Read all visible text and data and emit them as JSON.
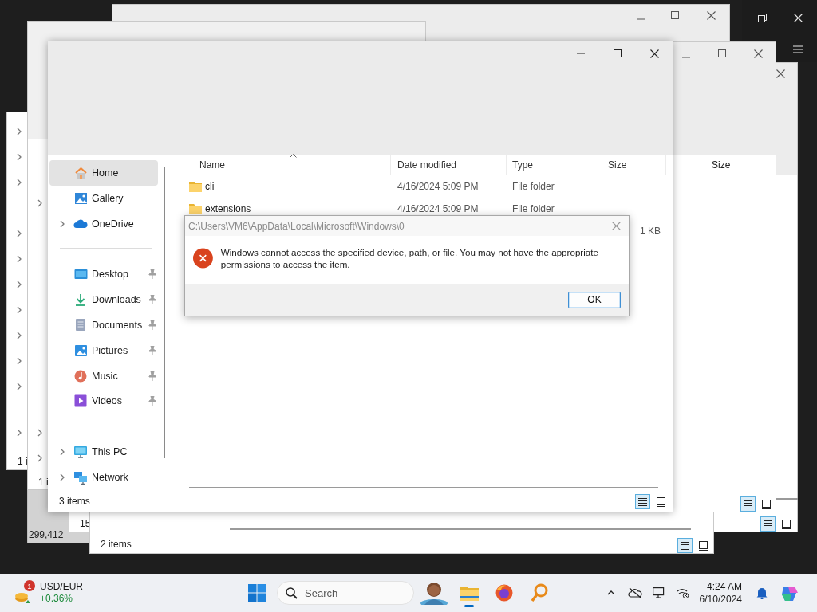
{
  "background_windows": [
    {
      "status": "1 i"
    },
    {
      "status": "299,412"
    },
    {
      "status": "15"
    },
    {
      "status": "1 i"
    },
    {
      "details_view_selected": true
    },
    {
      "status": "2 items",
      "details_view_selected": true
    },
    {
      "column": "Size",
      "details_view_selected": true
    }
  ],
  "explorer": {
    "sidebar_groups": [
      {
        "items": [
          {
            "label": "Home",
            "kind": "home",
            "selected": true,
            "expandable": false,
            "pinned": false
          },
          {
            "label": "Gallery",
            "kind": "gallery",
            "selected": false,
            "expandable": false,
            "pinned": false
          },
          {
            "label": "OneDrive",
            "kind": "onedrive",
            "selected": false,
            "expandable": true,
            "pinned": false
          }
        ]
      },
      {
        "items": [
          {
            "label": "Desktop",
            "kind": "desktop",
            "selected": false,
            "expandable": false,
            "pinned": true
          },
          {
            "label": "Downloads",
            "kind": "downloads",
            "selected": false,
            "expandable": false,
            "pinned": true
          },
          {
            "label": "Documents",
            "kind": "documents",
            "selected": false,
            "expandable": false,
            "pinned": true
          },
          {
            "label": "Pictures",
            "kind": "pictures",
            "selected": false,
            "expandable": false,
            "pinned": true
          },
          {
            "label": "Music",
            "kind": "music",
            "selected": false,
            "expandable": false,
            "pinned": true
          },
          {
            "label": "Videos",
            "kind": "videos",
            "selected": false,
            "expandable": false,
            "pinned": true
          }
        ]
      },
      {
        "items": [
          {
            "label": "This PC",
            "kind": "thispc",
            "selected": false,
            "expandable": true,
            "pinned": false
          },
          {
            "label": "Network",
            "kind": "network",
            "selected": false,
            "expandable": true,
            "pinned": false
          }
        ]
      }
    ],
    "columns": [
      {
        "label": "Name",
        "sorted": true
      },
      {
        "label": "Date modified",
        "sorted": false
      },
      {
        "label": "Type",
        "sorted": false
      },
      {
        "label": "Size",
        "sorted": false
      }
    ],
    "rows": [
      {
        "kind": "folder",
        "name": "cli",
        "date_modified": "4/16/2024 5:09 PM",
        "type": "File folder"
      },
      {
        "kind": "folder",
        "name": "extensions",
        "date_modified": "4/16/2024 5:09 PM",
        "type": "File folder"
      },
      {
        "kind": "file",
        "size": "1 KB"
      }
    ],
    "status": "3 items",
    "views": [
      {
        "kind": "details",
        "selected": true
      },
      {
        "kind": "tiles",
        "selected": false
      }
    ]
  },
  "dialog": {
    "title": "C:\\Users\\VM6\\AppData\\Local\\Microsoft\\Windows\\0",
    "message": "Windows cannot access the specified device, path, or file. You may not have the appropriate permissions to access the item.",
    "button": "OK"
  },
  "taskbar": {
    "widget": {
      "title": "USD/EUR",
      "change": "+0.36%",
      "badge": "1"
    },
    "search": {
      "placeholder": "Search"
    },
    "time": "4:24 AM",
    "date": "6/10/2024"
  }
}
